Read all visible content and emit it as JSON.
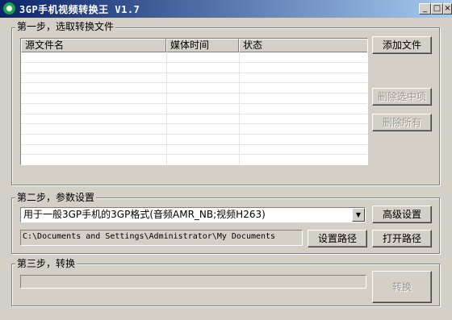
{
  "window": {
    "title": "3GP手机视频转换王 V1.7",
    "minimize": "_",
    "maximize": "□",
    "close": "×"
  },
  "step1": {
    "label": "第一步，选取转换文件",
    "columns": [
      "源文件名",
      "媒体时间",
      "状态"
    ],
    "add_button": "添加文件",
    "remove_selected_button": "删除选中项",
    "remove_all_button": "删除所有"
  },
  "step2": {
    "label": "第二步，参数设置",
    "format_selected": "用于一般3GP手机的3GP格式(音频AMR_NB;视频H263)",
    "advanced_button": "高级设置",
    "output_path": "C:\\Documents and Settings\\Administrator\\My Documents",
    "set_path_button": "设置路径",
    "open_path_button": "打开路径"
  },
  "step3": {
    "label": "第三步，转换",
    "progress": 0,
    "convert_button": "转换"
  }
}
